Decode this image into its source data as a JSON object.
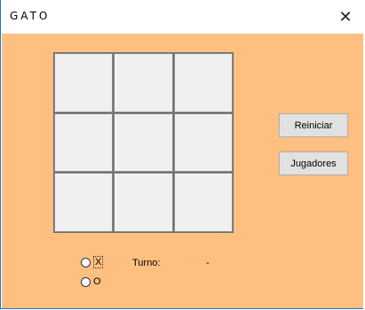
{
  "window": {
    "title": "GATO",
    "close_glyph": "✕"
  },
  "board": {
    "cells": [
      "",
      "",
      "",
      "",
      "",
      "",
      "",
      "",
      ""
    ]
  },
  "buttons": {
    "reiniciar": "Reiniciar",
    "jugadores": "Jugadores"
  },
  "options": [
    {
      "label": "X",
      "checked": false
    },
    {
      "label": "O",
      "checked": false
    }
  ],
  "turno": {
    "label": "Turno:",
    "value": "-"
  },
  "colors": {
    "background": "#ffbf80",
    "cell": "#f0f0f0",
    "grid_line": "#6b6b6b"
  }
}
